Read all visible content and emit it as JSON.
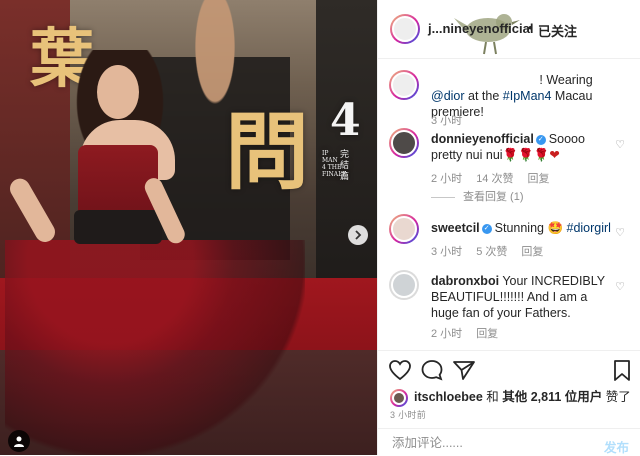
{
  "post_header": {
    "username": "jasmineyenofficial",
    "username_visible": "j...nineyenofficial",
    "separator": "•",
    "follow_status": "已关注"
  },
  "photo": {
    "poster_text_1": "葉",
    "poster_text_2": "問",
    "poster_text_3": "4",
    "poster_side_text": "完結篇",
    "poster_subtitle": "IP MAN 4 THE FINALE",
    "next_icon": "chevron-right-icon",
    "tag_icon": "person-tag-icon"
  },
  "caption": {
    "username": "jasmineyenofficial",
    "text_prefix": "! Wearing ",
    "mention": "@dior",
    "text_mid": " at the ",
    "hashtag": "#IpMan4",
    "text_suffix": " Macau premiere!",
    "time": "3 小时"
  },
  "comments": [
    {
      "username": "donnieyenofficial",
      "verified": true,
      "text": "Soooo pretty nui nui",
      "emoji": "🌹🌹🌹❤",
      "time": "2 小时",
      "likes": "14 次赞",
      "reply": "回复",
      "view_replies": "查看回复 (1)"
    },
    {
      "username": "sweetcil",
      "verified": true,
      "text": "Stunning 🤩 ",
      "hashtag": "#diorgirl",
      "time": "3 小时",
      "likes": "5 次赞",
      "reply": "回复"
    },
    {
      "username": "dabronxboi",
      "verified": false,
      "text": "Your INCREDIBLY BEAUTIFUL!!!!!!! And I am a huge fan of your Fathers.",
      "time": "2 小时",
      "reply": "回复"
    }
  ],
  "actions": {
    "like_icon": "heart-icon",
    "comment_icon": "comment-icon",
    "share_icon": "share-icon",
    "save_icon": "bookmark-icon"
  },
  "likes_line": {
    "user": "itschloebee",
    "and": " 和 ",
    "others": "其他 2,811 位用户",
    "suffix": " 赞了"
  },
  "timestamp": "3 小时前",
  "compose": {
    "placeholder": "添加评论......",
    "post_label": "发布"
  }
}
